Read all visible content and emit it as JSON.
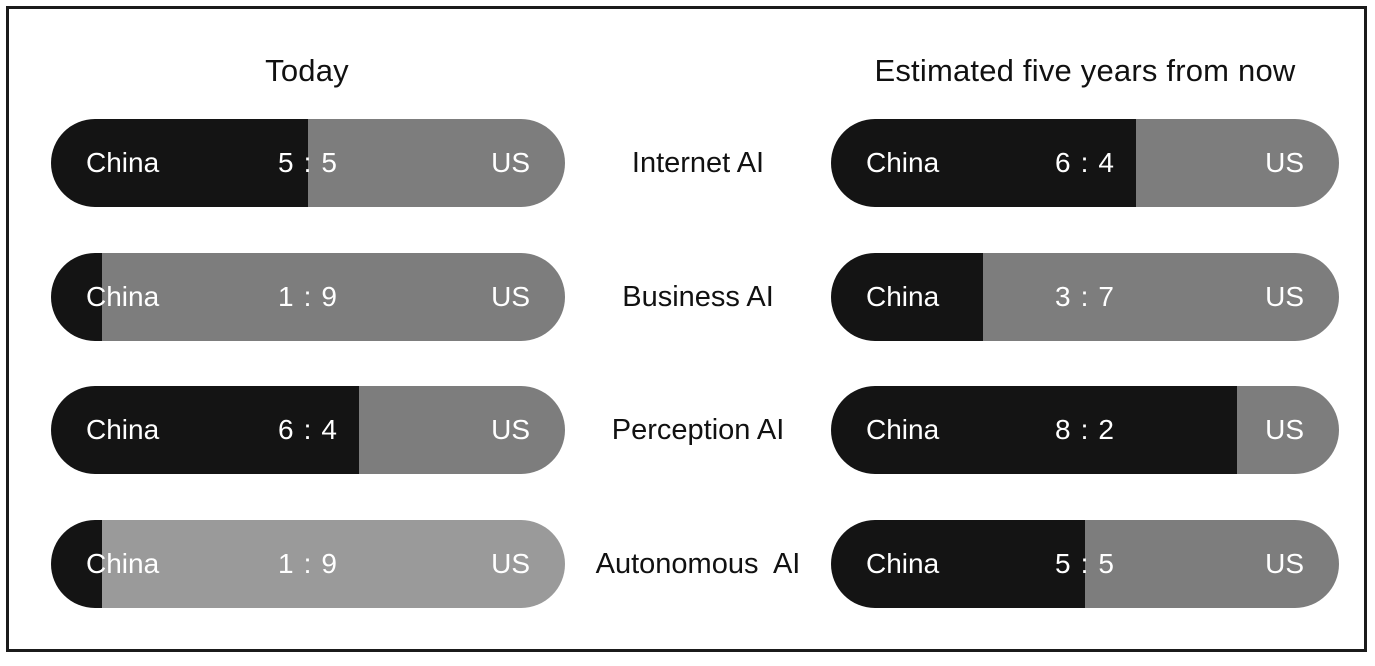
{
  "headings": {
    "left": "Today",
    "right": "Estimated five years from now"
  },
  "labels": {
    "china": "China",
    "us": "US",
    "separator": ":"
  },
  "colors": {
    "china_black": "#141414",
    "us_gray": "#7d7d7d",
    "us_gray_light": "#9a9a9a",
    "text_white": "#ffffff",
    "text_dark": "#111111",
    "frame_border": "#1b1b1b"
  },
  "chart_data": {
    "type": "bar",
    "title": "",
    "subtitle": "",
    "xlabel": "",
    "ylabel": "",
    "grid": false,
    "legend_position": "none",
    "categories": [
      "Internet AI",
      "Business AI",
      "Perception AI",
      "Autonomous  AI"
    ],
    "series": [
      {
        "name": "Today",
        "china": [
          5,
          1,
          6,
          1
        ],
        "us": [
          5,
          9,
          4,
          9
        ]
      },
      {
        "name": "Estimated five years from now",
        "china": [
          6,
          3,
          8,
          5
        ],
        "us": [
          4,
          7,
          2,
          5
        ]
      }
    ],
    "scale_total": 10
  },
  "rows": [
    {
      "category": "Internet AI",
      "today": {
        "china": "5",
        "us": "5",
        "china_pct": 50,
        "gray": "#7d7d7d"
      },
      "future": {
        "china": "6",
        "us": "4",
        "china_pct": 60,
        "gray": "#7d7d7d"
      }
    },
    {
      "category": "Business AI",
      "today": {
        "china": "1",
        "us": "9",
        "china_pct": 10,
        "gray": "#7d7d7d"
      },
      "future": {
        "china": "3",
        "us": "7",
        "china_pct": 30,
        "gray": "#7d7d7d"
      }
    },
    {
      "category": "Perception AI",
      "today": {
        "china": "6",
        "us": "4",
        "china_pct": 60,
        "gray": "#7d7d7d"
      },
      "future": {
        "china": "8",
        "us": "2",
        "china_pct": 80,
        "gray": "#7d7d7d"
      }
    },
    {
      "category": "Autonomous  AI",
      "today": {
        "china": "1",
        "us": "9",
        "china_pct": 10,
        "gray": "#9a9a9a"
      },
      "future": {
        "china": "5",
        "us": "5",
        "china_pct": 50,
        "gray": "#7d7d7d"
      }
    }
  ]
}
